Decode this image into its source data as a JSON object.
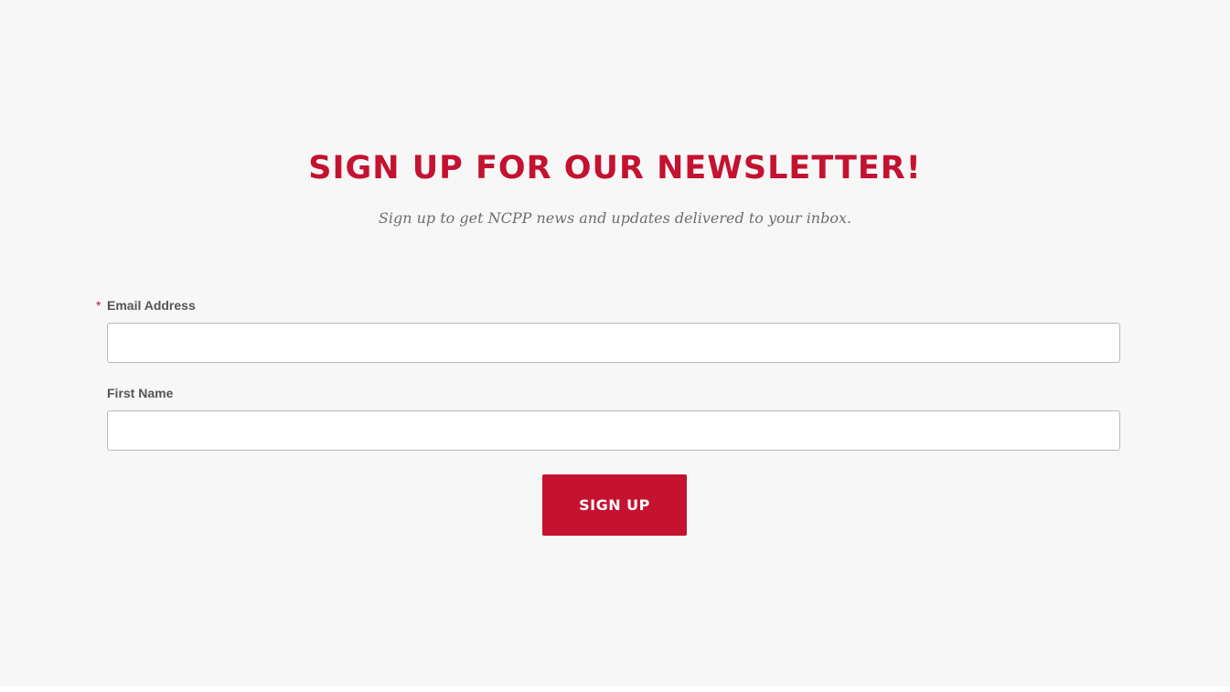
{
  "newsletter": {
    "title": "SIGN UP FOR OUR NEWSLETTER!",
    "subtitle": "Sign up to get NCPP news and updates delivered to your inbox."
  },
  "form": {
    "email": {
      "required_mark": "*",
      "label": "Email Address",
      "value": "",
      "placeholder": ""
    },
    "first_name": {
      "label": "First Name",
      "value": "",
      "placeholder": ""
    },
    "submit_label": "SIGN UP"
  },
  "colors": {
    "accent": "#c41230",
    "background": "#f7f7f7",
    "label": "#555555",
    "subtitle": "#6e6e6e"
  }
}
